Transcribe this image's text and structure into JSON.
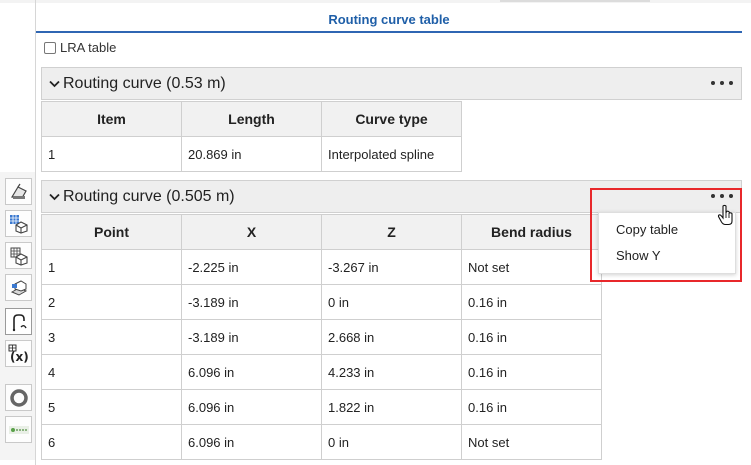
{
  "panel": {
    "title": "Routing curve table"
  },
  "lra": {
    "label": "LRA table",
    "checked": false
  },
  "section1": {
    "title": "Routing curve (0.53 m)",
    "columns": [
      "Item",
      "Length",
      "Curve type"
    ],
    "rows": [
      [
        "1",
        "20.869 in",
        "Interpolated spline"
      ]
    ]
  },
  "section2": {
    "title": "Routing curve (0.505 m)",
    "columns": [
      "Point",
      "X",
      "Z",
      "Bend radius"
    ],
    "rows": [
      [
        "1",
        "-2.225 in",
        "-3.267 in",
        "Not set"
      ],
      [
        "2",
        "-3.189 in",
        "0 in",
        "0.16 in"
      ],
      [
        "3",
        "-3.189 in",
        "2.668 in",
        "0.16 in"
      ],
      [
        "4",
        "6.096 in",
        "4.233 in",
        "0.16 in"
      ],
      [
        "5",
        "6.096 in",
        "1.822 in",
        "0.16 in"
      ],
      [
        "6",
        "6.096 in",
        "0 in",
        "Not set"
      ]
    ]
  },
  "menu": {
    "items": [
      "Copy table",
      "Show Y"
    ]
  },
  "colors": {
    "title_blue": "#1f5fa8",
    "highlight_red": "#e8282b"
  },
  "icons": [
    "sheet-metal-icon",
    "frame-icon",
    "frame-table-icon",
    "drawing-icon",
    "routing-curve-icon",
    "variable-icon",
    "ring-icon",
    "app-logo-icon",
    "more-options-icon",
    "chevron-down-icon",
    "hand-cursor-icon"
  ]
}
